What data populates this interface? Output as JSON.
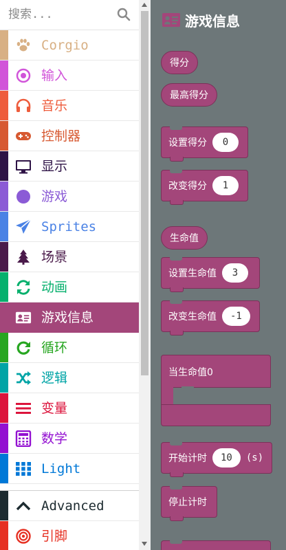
{
  "search": {
    "placeholder": "搜索...",
    "icon": "search-icon"
  },
  "categories": [
    {
      "label": "Corgio",
      "color": "#d8b084",
      "icon": "paw-icon"
    },
    {
      "label": "输入",
      "color": "#d154d9",
      "icon": "target-icon"
    },
    {
      "label": "音乐",
      "color": "#ee5c3c",
      "icon": "headphones-icon"
    },
    {
      "label": "控制器",
      "color": "#d75931",
      "icon": "gamepad-icon"
    },
    {
      "label": "显示",
      "color": "#2e1346",
      "icon": "monitor-icon"
    },
    {
      "label": "游戏",
      "color": "#8b5bd6",
      "icon": "circle-icon"
    },
    {
      "label": "Sprites",
      "color": "#4a82e5",
      "icon": "paper-plane-icon"
    },
    {
      "label": "场景",
      "color": "#4a1a4a",
      "icon": "tree-icon"
    },
    {
      "label": "动画",
      "color": "#06b06d",
      "icon": "refresh-icon"
    },
    {
      "label": "游戏信息",
      "color": "#a3467a",
      "icon": "id-card-icon",
      "selected": true
    },
    {
      "label": "循环",
      "color": "#27a621",
      "icon": "loop-icon"
    },
    {
      "label": "逻辑",
      "color": "#00a4a6",
      "icon": "shuffle-icon"
    },
    {
      "label": "变量",
      "color": "#dc143c",
      "icon": "lines-icon"
    },
    {
      "label": "数学",
      "color": "#9310d1",
      "icon": "calculator-icon"
    },
    {
      "label": "Light",
      "color": "#0078d7",
      "icon": "grid-icon"
    }
  ],
  "advanced": [
    {
      "label": "Advanced",
      "color": "#1d2b30",
      "icon": "chevron-up-icon"
    },
    {
      "label": "引脚",
      "color": "#e63022",
      "icon": "pins-icon"
    }
  ],
  "flyout": {
    "title": "游戏信息",
    "icon": "id-card-icon",
    "color": "#a3467a",
    "background": "#6d7779",
    "blocks": {
      "score": "得分",
      "high_score": "最高得分",
      "set_score": {
        "label": "设置得分",
        "value": "0"
      },
      "change_score": {
        "label": "改变得分",
        "value": "1"
      },
      "life": "生命值",
      "set_life": {
        "label": "设置生命值",
        "value": "3"
      },
      "change_life": {
        "label": "改变生命值",
        "value": "-1"
      },
      "on_life_zero": "当生命值0",
      "start_timer": {
        "label": "开始计时",
        "value": "10",
        "unit": "(s)"
      },
      "stop_timer": "停止计时"
    }
  }
}
